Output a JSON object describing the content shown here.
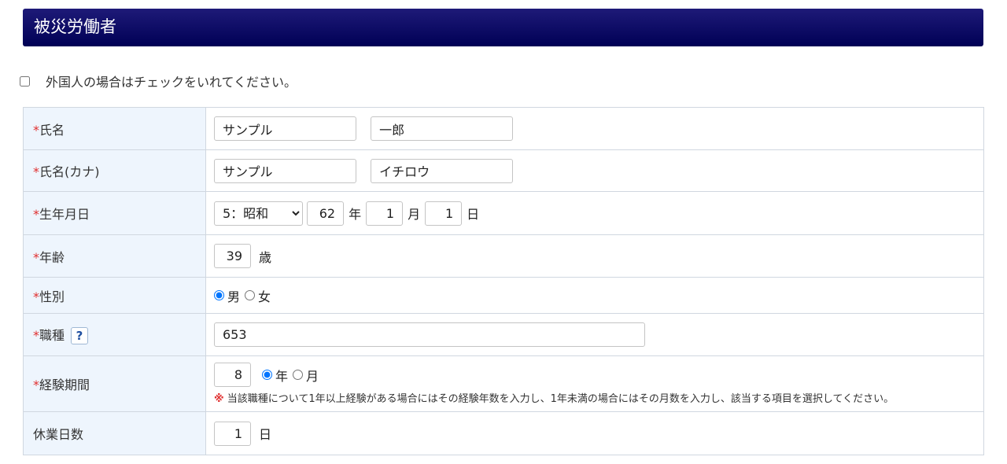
{
  "header": {
    "title": "被災労働者"
  },
  "foreign": {
    "label": "外国人の場合はチェックをいれてください。",
    "checked": false
  },
  "required_mark": "*",
  "rows": {
    "name": {
      "label": "氏名",
      "last": "サンプル",
      "first": "一郎"
    },
    "kana": {
      "label": "氏名(カナ)",
      "last": "サンプル",
      "first": "イチロウ"
    },
    "birth": {
      "label": "生年月日",
      "era_selected": "5：昭和",
      "year": "62",
      "year_unit": "年",
      "month": "1",
      "month_unit": "月",
      "day": "1",
      "day_unit": "日"
    },
    "age": {
      "label": "年齢",
      "value": "39",
      "unit": "歳"
    },
    "gender": {
      "label": "性別",
      "options": [
        "男",
        "女"
      ],
      "selected": "男"
    },
    "occupation": {
      "label": "職種",
      "help": "?",
      "value": "653"
    },
    "experience": {
      "label": "経験期間",
      "value": "8",
      "options": [
        "年",
        "月"
      ],
      "selected": "年",
      "note_mark": "※",
      "note": "当該職種について1年以上経験がある場合にはその経験年数を入力し、1年未満の場合にはその月数を入力し、該当する項目を選択してください。"
    },
    "leave_days": {
      "label": "休業日数",
      "value": "1",
      "unit": "日"
    }
  },
  "colors": {
    "header_bg": "#0a0a66",
    "label_bg": "#eef5fd",
    "required": "#e03030"
  }
}
